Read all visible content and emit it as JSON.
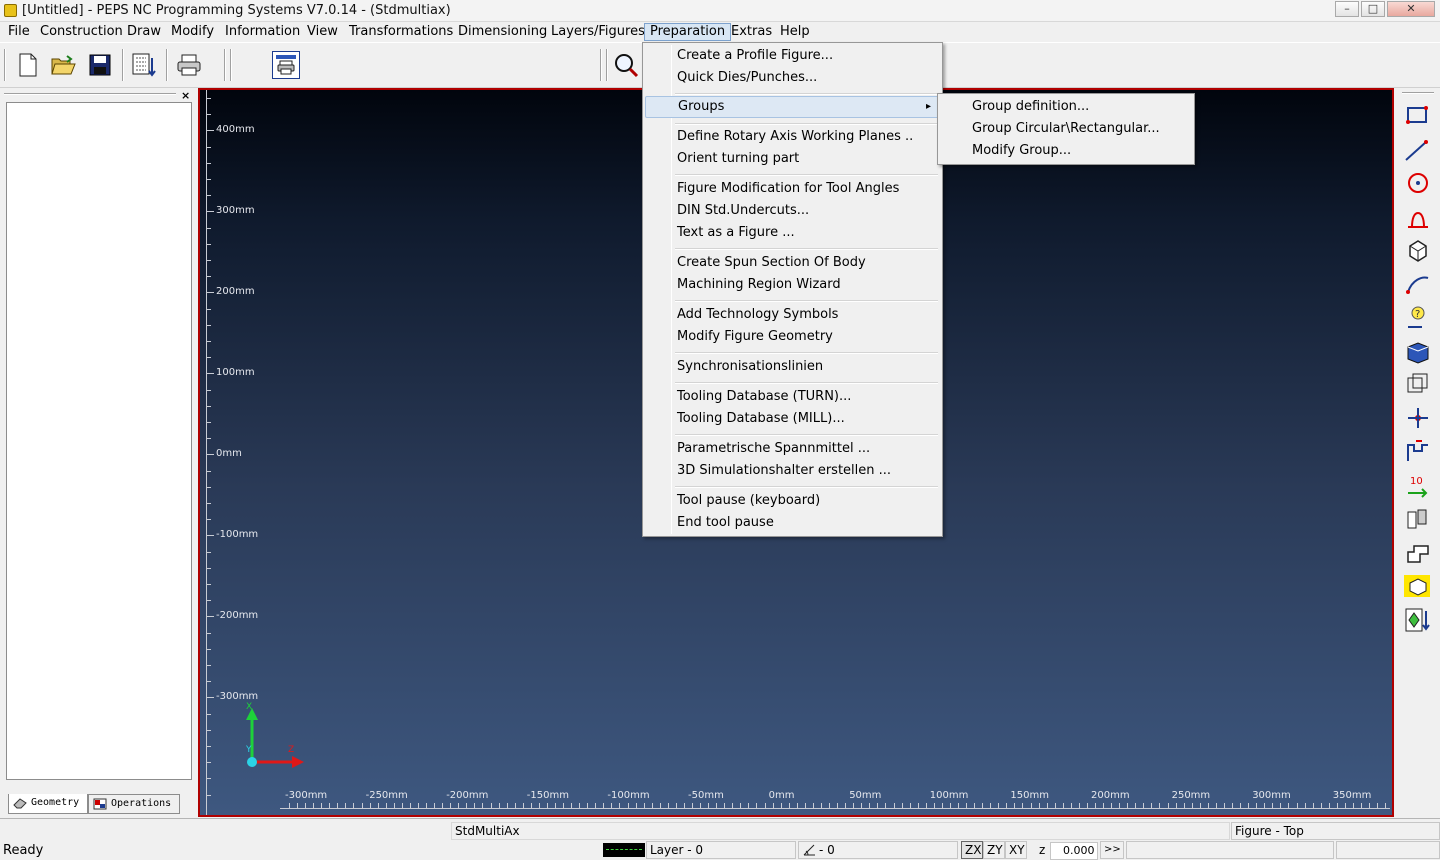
{
  "window": {
    "title": "[Untitled] - PEPS NC Programming Systems V7.0.14 - (Stdmultiax)",
    "controls": {
      "minimize": "–",
      "maximize": "□",
      "close": "✕"
    }
  },
  "menubar": [
    "File",
    "Construction",
    "Draw",
    "Modify",
    "Information",
    "View",
    "Transformations",
    "Dimensioning",
    "Layers/Figures",
    "Preparation",
    "Extras",
    "Help"
  ],
  "active_menu": "Preparation",
  "preparation_menu": {
    "items": [
      "Create a Profile Figure...",
      "Quick Dies/Punches...",
      "Groups",
      "Define Rotary Axis Working Planes ..",
      "Orient turning part",
      "Figure Modification for Tool Angles",
      "DIN Std.Undercuts...",
      "Text as a Figure ...",
      "Create Spun Section Of Body",
      "Machining Region Wizard",
      "Add Technology Symbols",
      "Modify Figure Geometry",
      "Synchronisationslinien",
      "Tooling Database (TURN)...",
      "Tooling Database (MILL)...",
      "Parametrische Spannmittel ...",
      "3D Simulationshalter erstellen ...",
      "Tool pause (keyboard)",
      "End tool pause"
    ],
    "submenu_arrow": "▸"
  },
  "groups_submenu": [
    "Group definition...",
    "Group Circular\\Rectangular...",
    "Modify Group..."
  ],
  "left_panel": {
    "close": "×",
    "tabs": [
      "Geometry",
      "Operations"
    ]
  },
  "canvas": {
    "y_labels": [
      "400mm",
      "300mm",
      "200mm",
      "100mm",
      "0mm",
      "-100mm",
      "-200mm",
      "-300mm"
    ],
    "x_labels": [
      "-300mm",
      "-250mm",
      "-200mm",
      "-150mm",
      "-100mm",
      "-50mm",
      "0mm",
      "50mm",
      "100mm",
      "150mm",
      "200mm",
      "250mm",
      "300mm",
      "350mm"
    ],
    "axis_x_label": "Z",
    "axis_y_label": "X",
    "axis_origin_label": "Y"
  },
  "toolbar_icons": [
    "new-file-icon",
    "open-folder-icon",
    "save-icon",
    "document-list-icon",
    "print-icon",
    "print-preview-icon",
    "zoom-icon"
  ],
  "right_toolbar_icons": [
    "rectangle-tool-icon",
    "line-tool-icon",
    "circle-tool-icon",
    "profile-tool-icon",
    "cube-tool-icon",
    "arc-tool-icon",
    "help-tool-icon",
    "solid-view-icon",
    "wireframe-icon",
    "move-tool-icon",
    "measure-tool-icon",
    "numbering-tool-icon",
    "tool-holder-icon",
    "turning-profile-icon",
    "yellow-part-icon",
    "insert-figure-icon"
  ],
  "status": {
    "ready": "Ready",
    "config": "StdMultiAx",
    "view": "Figure - Top",
    "layer": "Layer - 0",
    "angle": "- 0",
    "planes": [
      "ZX",
      "ZY",
      "XY"
    ],
    "z_label": "z",
    "z_value": "0.000",
    "more": ">>"
  },
  "colors": {
    "canvas_border": "#b00000",
    "axis_green": "#1ed13a",
    "axis_red": "#e01818"
  }
}
